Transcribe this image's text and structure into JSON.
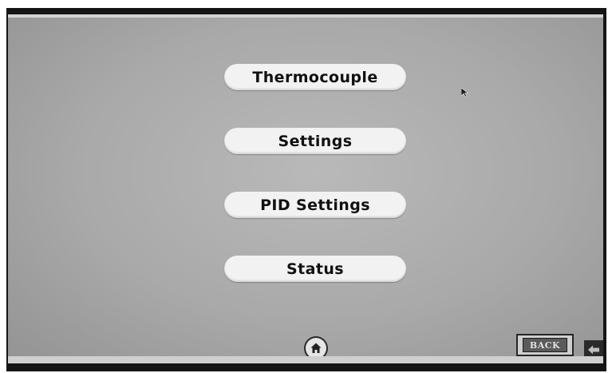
{
  "menu": {
    "buttons": [
      {
        "label": "Thermocouple"
      },
      {
        "label": "Settings"
      },
      {
        "label": "PID Settings"
      },
      {
        "label": "Status"
      }
    ]
  },
  "footer": {
    "home_icon": "home-icon",
    "back_label": "BACK",
    "arrow_icon": "arrow-left-icon"
  },
  "colors": {
    "screen_background": "#a9a9a9",
    "button_fill": "#f2f2f2",
    "bezel": "#151515"
  }
}
